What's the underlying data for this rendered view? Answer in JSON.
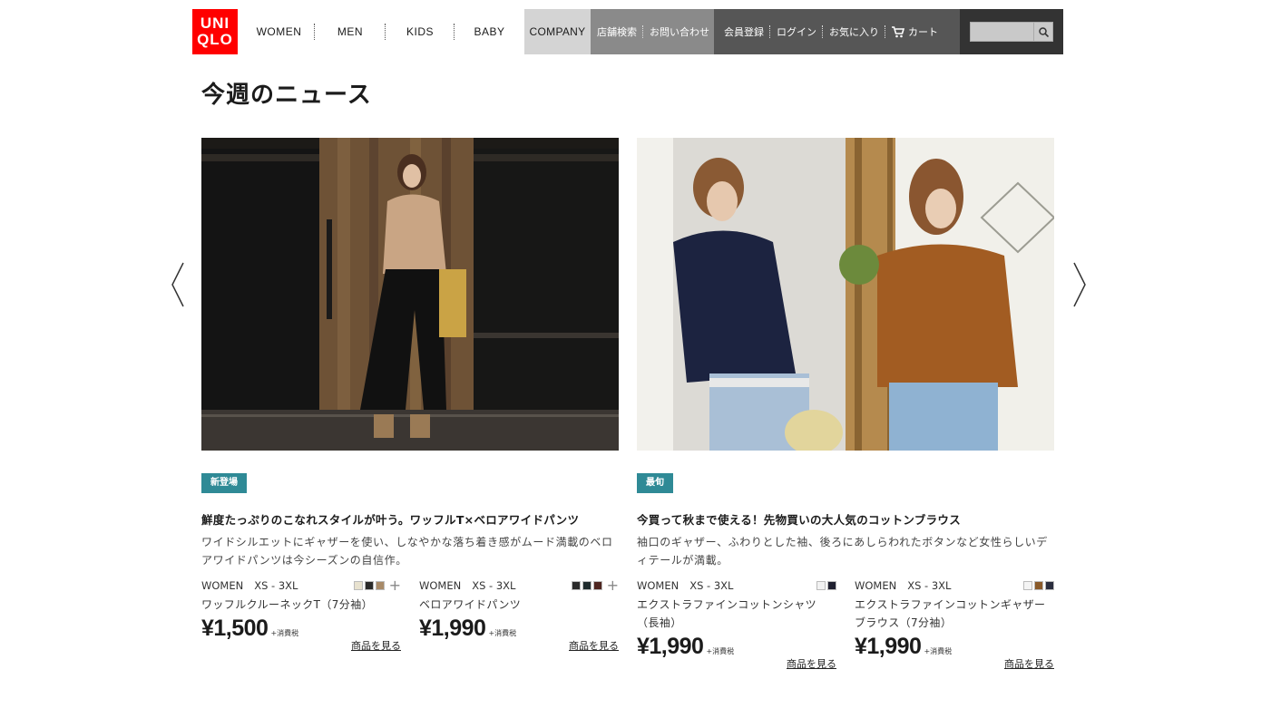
{
  "logo": {
    "line1": "UNI",
    "line2": "QLO"
  },
  "nav": {
    "categories": [
      "WOMEN",
      "MEN",
      "KIDS",
      "BABY"
    ],
    "company": "COMPANY",
    "links_grey": [
      "店舗検索",
      "お問い合わせ"
    ],
    "links_dark": [
      "会員登録",
      "ログイン",
      "お気に入り"
    ],
    "cart": "カート",
    "search_placeholder": ""
  },
  "page_title": "今週のニュース",
  "colors": {
    "brand": "#ff0000",
    "badge": "#2f8a96"
  },
  "cards": [
    {
      "badge": "新登場",
      "headline": "鮮度たっぷりのこなれスタイルが叶う。ワッフルT×ベロアワイドパンツ",
      "description": "ワイドシルエットにギャザーを使い、しなやかな落ち着き感がムード満載のベロアワイドパンツは今シーズンの自信作。",
      "products": [
        {
          "gender": "WOMEN",
          "sizes": "XS - 3XL",
          "name": "ワッフルクルーネックT（7分袖）",
          "price": "¥1,500",
          "tax": "+消費税",
          "link": "商品を見る",
          "swatches": [
            "#e8e2cf",
            "#2a2a2a",
            "#a88a68"
          ],
          "more": true
        },
        {
          "gender": "WOMEN",
          "sizes": "XS - 3XL",
          "name": "ベロアワイドパンツ",
          "price": "¥1,990",
          "tax": "+消費税",
          "link": "商品を見る",
          "swatches": [
            "#2b2b2b",
            "#1e2a2c",
            "#4e2520"
          ],
          "more": true
        }
      ]
    },
    {
      "badge": "最旬",
      "headline": "今買って秋まで使える！先物買いの大人気のコットンブラウス",
      "description": "袖口のギャザー、ふわりとした袖、後ろにあしらわれたボタンなど女性らしいディテールが満載。",
      "products": [
        {
          "gender": "WOMEN",
          "sizes": "XS - 3XL",
          "name": "エクストラファインコットンシャツ（長袖）",
          "price": "¥1,990",
          "tax": "+消費税",
          "link": "商品を見る",
          "swatches": [
            "#f2f2f2",
            "#1f2030"
          ],
          "more": false
        },
        {
          "gender": "WOMEN",
          "sizes": "XS - 3XL",
          "name": "エクストラファインコットンギャザーブラウス（7分袖）",
          "price": "¥1,990",
          "tax": "+消費税",
          "link": "商品を見る",
          "swatches": [
            "#f4f4f4",
            "#8a5a2a",
            "#2a2d3e"
          ],
          "more": false
        }
      ]
    }
  ]
}
